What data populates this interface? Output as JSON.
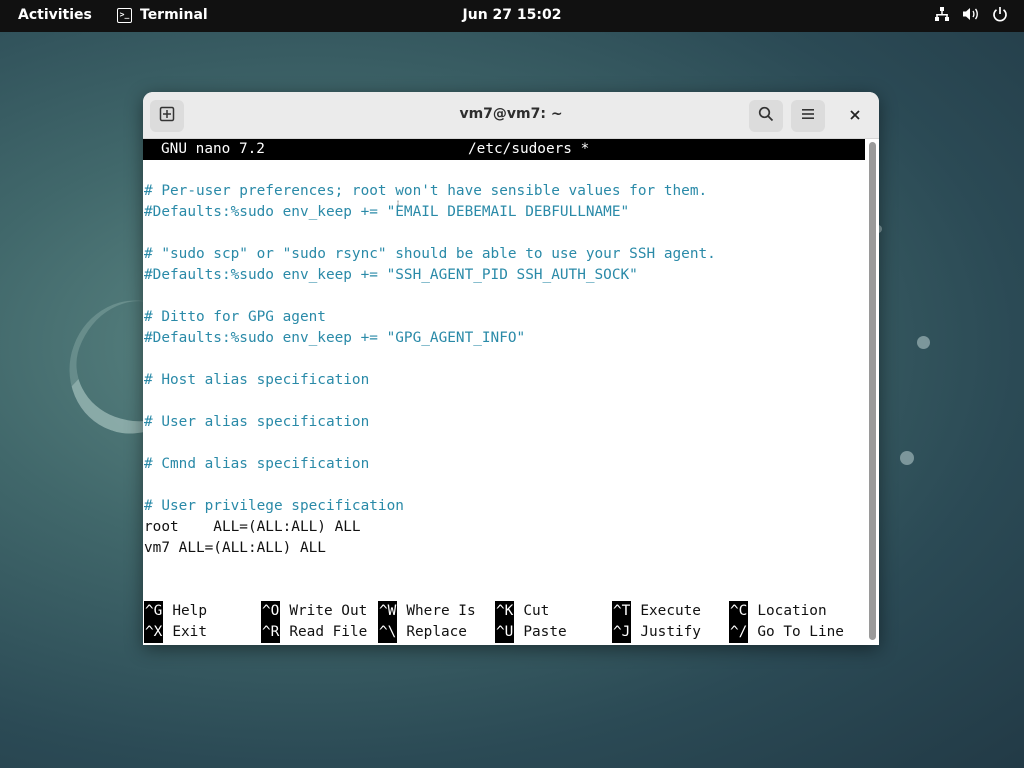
{
  "topbar": {
    "activities": "Activities",
    "app_name": "Terminal",
    "clock": "Jun 27  15:02",
    "status_icons": [
      "network-icon",
      "volume-icon",
      "power-icon"
    ]
  },
  "window": {
    "title": "vm7@vm7: ~",
    "buttons": [
      "new-tab-icon",
      "search-icon",
      "hamburger-menu-icon",
      "close-icon"
    ]
  },
  "nano": {
    "version": "GNU nano 7.2",
    "filename": "/etc/sudoers *",
    "lines": [
      {
        "text": "",
        "type": "plain"
      },
      {
        "text": "# Per-user preferences; root won't have sensible values for them.",
        "type": "comment"
      },
      {
        "text": "#Defaults:%sudo env_keep += \"EMAIL DEBEMAIL DEBFULLNAME\"",
        "type": "comment"
      },
      {
        "text": "",
        "type": "plain"
      },
      {
        "text": "# \"sudo scp\" or \"sudo rsync\" should be able to use your SSH agent.",
        "type": "comment"
      },
      {
        "text": "#Defaults:%sudo env_keep += \"SSH_AGENT_PID SSH_AUTH_SOCK\"",
        "type": "comment"
      },
      {
        "text": "",
        "type": "plain"
      },
      {
        "text": "# Ditto for GPG agent",
        "type": "comment"
      },
      {
        "text": "#Defaults:%sudo env_keep += \"GPG_AGENT_INFO\"",
        "type": "comment"
      },
      {
        "text": "",
        "type": "plain"
      },
      {
        "text": "# Host alias specification",
        "type": "comment"
      },
      {
        "text": "",
        "type": "plain"
      },
      {
        "text": "# User alias specification",
        "type": "comment"
      },
      {
        "text": "",
        "type": "plain"
      },
      {
        "text": "# Cmnd alias specification",
        "type": "comment"
      },
      {
        "text": "",
        "type": "plain"
      },
      {
        "text": "# User privilege specification",
        "type": "comment"
      },
      {
        "text": "root    ALL=(ALL:ALL) ALL",
        "type": "plain"
      },
      {
        "text": "vm7 ALL=(ALL:ALL) ALL",
        "type": "plain"
      }
    ],
    "shortcuts": [
      [
        {
          "key": "^G",
          "label": "Help"
        },
        {
          "key": "^O",
          "label": "Write Out"
        },
        {
          "key": "^W",
          "label": "Where Is"
        },
        {
          "key": "^K",
          "label": "Cut"
        },
        {
          "key": "^T",
          "label": "Execute"
        },
        {
          "key": "^C",
          "label": "Location"
        }
      ],
      [
        {
          "key": "^X",
          "label": "Exit"
        },
        {
          "key": "^R",
          "label": "Read File"
        },
        {
          "key": "^\\",
          "label": "Replace"
        },
        {
          "key": "^U",
          "label": "Paste"
        },
        {
          "key": "^J",
          "label": "Justify"
        },
        {
          "key": "^/",
          "label": "Go To Line"
        }
      ]
    ]
  }
}
